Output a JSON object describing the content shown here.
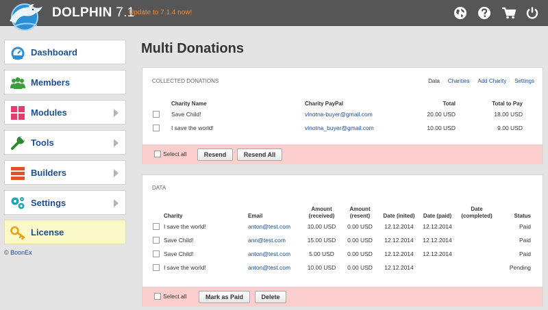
{
  "header": {
    "logo_icon": "dolphin-logo-icon",
    "app_name": "DOLPHIN",
    "version": "7.1",
    "update_text": "Update to 7.1.4 now!",
    "icons": [
      "globe-icon",
      "help-icon",
      "cart-icon",
      "power-icon"
    ]
  },
  "sidebar": {
    "items": [
      {
        "label": "Dashboard",
        "icon": "dashboard-icon",
        "has_arrow": false
      },
      {
        "label": "Members",
        "icon": "members-icon",
        "has_arrow": false
      },
      {
        "label": "Modules",
        "icon": "modules-icon",
        "has_arrow": true
      },
      {
        "label": "Tools",
        "icon": "wrench-icon",
        "has_arrow": true
      },
      {
        "label": "Builders",
        "icon": "builders-icon",
        "has_arrow": true
      },
      {
        "label": "Settings",
        "icon": "gears-icon",
        "has_arrow": true
      },
      {
        "label": "License",
        "icon": "key-icon",
        "has_arrow": false
      }
    ],
    "copyright_symbol": "©",
    "copyright_name": "BoonEx"
  },
  "main": {
    "title": "Multi Donations",
    "collected": {
      "heading": "COLLECTED DONATIONS",
      "links": [
        "Data",
        "Charities",
        "Add Charity",
        "Settings"
      ],
      "columns": [
        "Charity Name",
        "Charity PayPal",
        "Total",
        "Total to Pay"
      ],
      "rows": [
        {
          "name": "Save Child!",
          "paypal": "vlnotna-buyer@gmail.com",
          "total": "20.00 USD",
          "to_pay": "18.00 USD"
        },
        {
          "name": "I save the world!",
          "paypal": "vlnotna_buyer@gmail.com",
          "total": "10.00 USD",
          "to_pay": "9.00 USD"
        }
      ],
      "select_all": "Select all",
      "buttons": [
        "Resend",
        "Resend All"
      ]
    },
    "data": {
      "heading": "DATA",
      "columns": [
        "Charity",
        "Email",
        "Amount (received)",
        "Amount (resent)",
        "Date (inited)",
        "Date (paid)",
        "Date (completed)",
        "Status"
      ],
      "rows": [
        {
          "charity": "I save the world!",
          "email": "anton@test.com",
          "received": "10.00 USD",
          "resent": "0.00 USD",
          "inited": "12.12.2014",
          "paid": "12.12.2014",
          "completed": "",
          "status": "Paid"
        },
        {
          "charity": "Save Child!",
          "email": "ann@test.com",
          "received": "15.00 USD",
          "resent": "0.00 USD",
          "inited": "12.12.2014",
          "paid": "12.12.2014",
          "completed": "",
          "status": "Paid"
        },
        {
          "charity": "Save Child!",
          "email": "anton@test.com",
          "received": "5.00 USD",
          "resent": "0.00 USD",
          "inited": "12.12.2014",
          "paid": "12.12.2014",
          "completed": "",
          "status": "Paid"
        },
        {
          "charity": "I save the world!",
          "email": "anton@test.com",
          "received": "10.00 USD",
          "resent": "0.00 USD",
          "inited": "12.12.2014",
          "paid": "",
          "completed": "",
          "status": "Pending"
        }
      ],
      "select_all": "Select all",
      "buttons": [
        "Mark as Paid",
        "Delete"
      ]
    }
  },
  "colors": {
    "topbar": "#565656",
    "accent_orange": "#f28c3a",
    "link_blue": "#1d4e8f",
    "footer_pink": "#fccfcf",
    "license_yellow": "#fbf9c9"
  }
}
